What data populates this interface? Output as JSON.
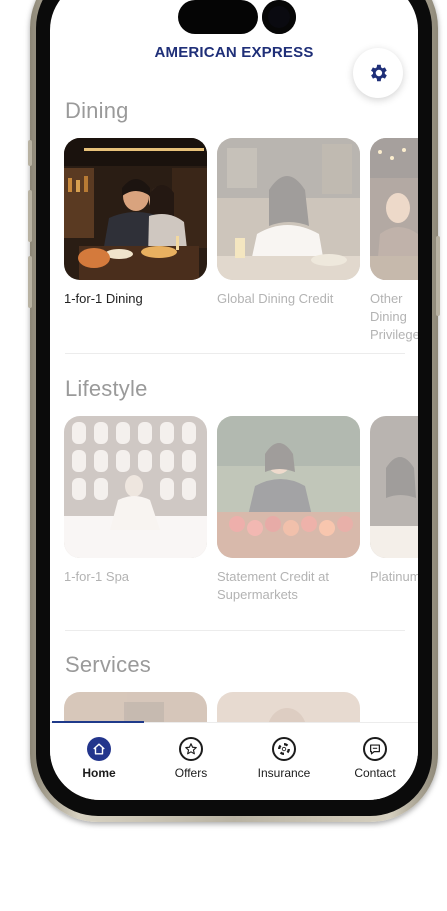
{
  "header": {
    "brand": "AMERICAN EXPRESS",
    "settings_icon": "gear-icon"
  },
  "sections": [
    {
      "title": "Dining",
      "cards": [
        {
          "label": "1-for-1 Dining",
          "active": true
        },
        {
          "label": "Global Dining Credit",
          "active": false
        },
        {
          "label": "Other Dining Privileges",
          "active": false
        }
      ]
    },
    {
      "title": "Lifestyle",
      "cards": [
        {
          "label": "1-for-1 Spa",
          "active": false
        },
        {
          "label": "Statement Credit at Supermarkets",
          "active": false
        },
        {
          "label": "Platinum",
          "active": false
        }
      ]
    },
    {
      "title": "Services",
      "cards": []
    }
  ],
  "tabs": [
    {
      "label": "Home",
      "icon": "home-icon",
      "active": true
    },
    {
      "label": "Offers",
      "icon": "star-badge-icon",
      "active": false
    },
    {
      "label": "Insurance",
      "icon": "lifebuoy-icon",
      "active": false
    },
    {
      "label": "Contact",
      "icon": "chat-bubble-icon",
      "active": false
    }
  ],
  "colors": {
    "brand": "#1f2f78",
    "tab_active": "#23358c"
  }
}
